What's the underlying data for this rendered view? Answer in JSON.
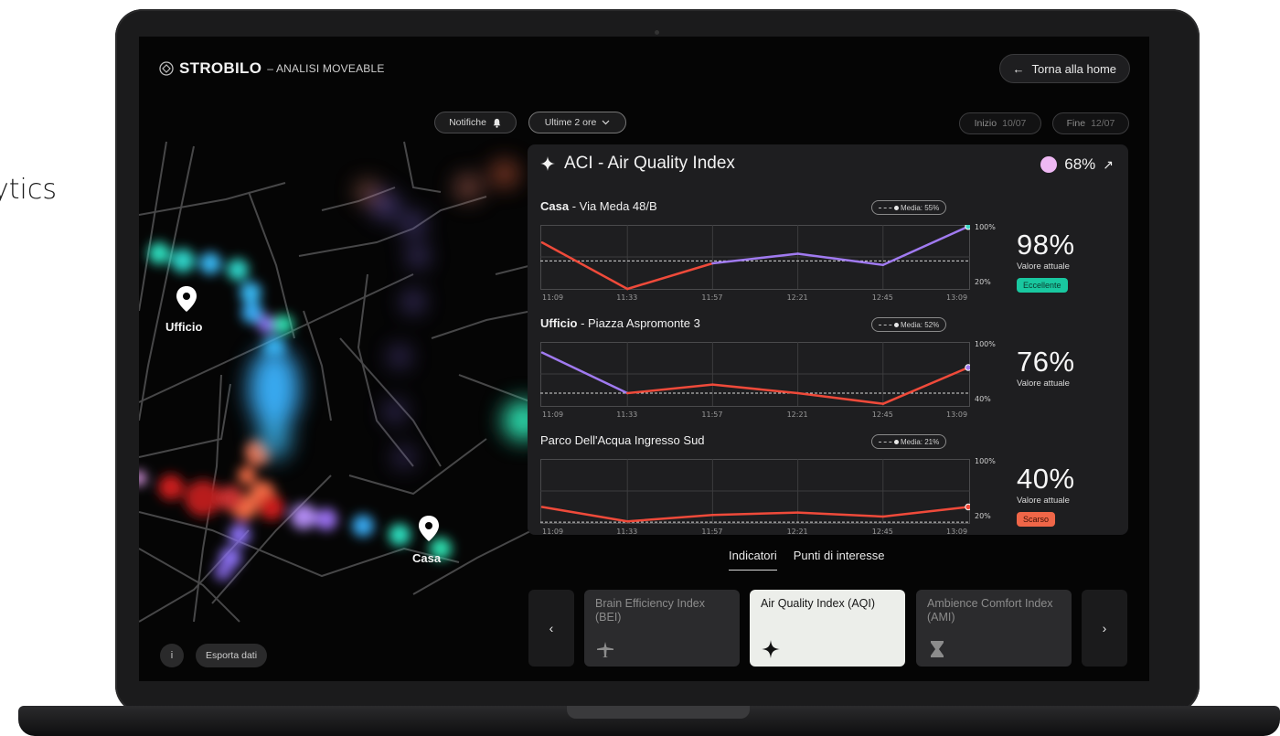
{
  "background": {
    "caption": "ytics"
  },
  "header": {
    "brand": "STROBILO",
    "subtitle": "– ANALISI MOVEABLE",
    "home_button": "Torna alla home"
  },
  "filters": {
    "notifications": "Notifiche",
    "range": "Ultime 2 ore",
    "start_label": "Inizio",
    "start_value": "10/07",
    "end_label": "Fine",
    "end_value": "12/07"
  },
  "map": {
    "labels": [
      "Ufficio",
      "Casa"
    ],
    "info_button": "i",
    "export_button": "Esporta dati"
  },
  "panel": {
    "title": "ACI - Air Quality Index",
    "score": "68%",
    "score_color": "#eeb8f3",
    "rows": [
      {
        "place_bold": "Casa",
        "place_rest": " - Via Meda 48/B",
        "media": "Media: 55%",
        "max_label": "100%",
        "min_label": "20%",
        "value": "98%",
        "value_caption": "Valore attuale",
        "badge": "Eccellente",
        "badge_type": "good"
      },
      {
        "place_bold": "Ufficio",
        "place_rest": " - Piazza Aspromonte 3",
        "media": "Media: 52%",
        "max_label": "100%",
        "min_label": "40%",
        "value": "76%",
        "value_caption": "Valore attuale",
        "badge": "",
        "badge_type": ""
      },
      {
        "place_bold": "",
        "place_rest": "Parco Dell'Acqua Ingresso Sud",
        "media": "Media: 21%",
        "max_label": "100%",
        "min_label": "20%",
        "value": "40%",
        "value_caption": "Valore attuale",
        "badge": "Scarso",
        "badge_type": "bad"
      }
    ],
    "times": [
      "11:09",
      "11:33",
      "11:57",
      "12:21",
      "12:45",
      "13:09"
    ]
  },
  "chart_data": [
    {
      "type": "line",
      "title": "Casa - Via Meda 48/B",
      "x": [
        "11:09",
        "11:33",
        "11:57",
        "12:21",
        "12:45",
        "13:09"
      ],
      "values": [
        78,
        20,
        52,
        64,
        50,
        98
      ],
      "mean": 55,
      "ylim": [
        20,
        100
      ]
    },
    {
      "type": "line",
      "title": "Ufficio - Piazza Aspromonte 3",
      "x": [
        "11:09",
        "11:33",
        "11:57",
        "12:21",
        "12:45",
        "13:09"
      ],
      "values": [
        90,
        52,
        60,
        52,
        42,
        76
      ],
      "mean": 52,
      "ylim": [
        40,
        100
      ]
    },
    {
      "type": "line",
      "title": "Parco Dell'Acqua Ingresso Sud",
      "x": [
        "11:09",
        "11:33",
        "11:57",
        "12:21",
        "12:45",
        "13:09"
      ],
      "values": [
        40,
        22,
        30,
        33,
        28,
        40
      ],
      "mean": 21,
      "ylim": [
        20,
        100
      ]
    }
  ],
  "tabs": [
    "Indicatori",
    "Punti di interesse"
  ],
  "cards": [
    {
      "label": "Brain Efficiency Index (BEI)",
      "icon": "plane-icon"
    },
    {
      "label": "Air Quality Index (AQI)",
      "icon": "sparkle-icon"
    },
    {
      "label": "Ambience Comfort Index (AMI)",
      "icon": "hourglass-icon"
    }
  ]
}
